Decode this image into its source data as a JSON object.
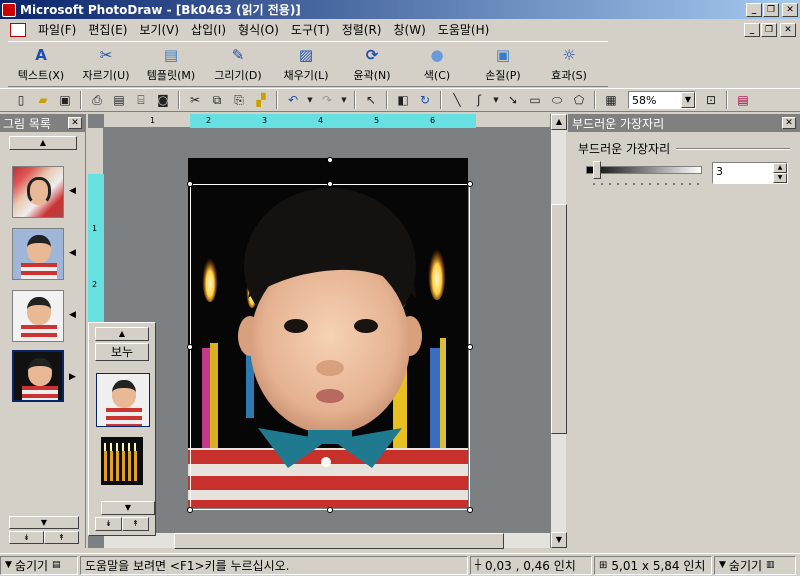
{
  "window": {
    "title": "Microsoft PhotoDraw - [Bk0463 (읽기 전용)]"
  },
  "menu": [
    "파일(F)",
    "편집(E)",
    "보기(V)",
    "삽입(I)",
    "형식(O)",
    "도구(T)",
    "정렬(R)",
    "창(W)",
    "도움말(H)"
  ],
  "big_toolbar": [
    {
      "label": "텍스트(X)",
      "icon": "text-a-icon"
    },
    {
      "label": "자르기(U)",
      "icon": "scissors-icon"
    },
    {
      "label": "템플릿(M)",
      "icon": "template-icon"
    },
    {
      "label": "그리기(D)",
      "icon": "draw-icon"
    },
    {
      "label": "채우기(L)",
      "icon": "fill-icon"
    },
    {
      "label": "윤곽(N)",
      "icon": "outline-icon"
    },
    {
      "label": "색(C)",
      "icon": "color-icon"
    },
    {
      "label": "손질(P)",
      "icon": "touchup-icon"
    },
    {
      "label": "효과(S)",
      "icon": "effects-icon"
    }
  ],
  "small_toolbar": {
    "zoom": "58%"
  },
  "left_panel": {
    "title": "그림 목록"
  },
  "popup": {
    "view_label": "보누"
  },
  "ruler": {
    "h": [
      "1",
      "2",
      "3",
      "4",
      "5",
      "6"
    ],
    "v": [
      "1",
      "2"
    ]
  },
  "right_panel": {
    "title": "부드러운 가장자리",
    "group_title": "부드러운 가장자리",
    "value": "3",
    "slider_level": 0.03
  },
  "status": {
    "hide_left": "숨기기",
    "help": "도움말을 보려면 <F1>키를 누르십시오.",
    "position": "0,03 , 0,46 인치",
    "size": "5,01 x 5,84 인치",
    "hide_right": "숨기기"
  },
  "colors": {
    "titlebar": "#0a246a",
    "ruler_highlight": "#66e0e0",
    "canvas": "#7d8082"
  }
}
